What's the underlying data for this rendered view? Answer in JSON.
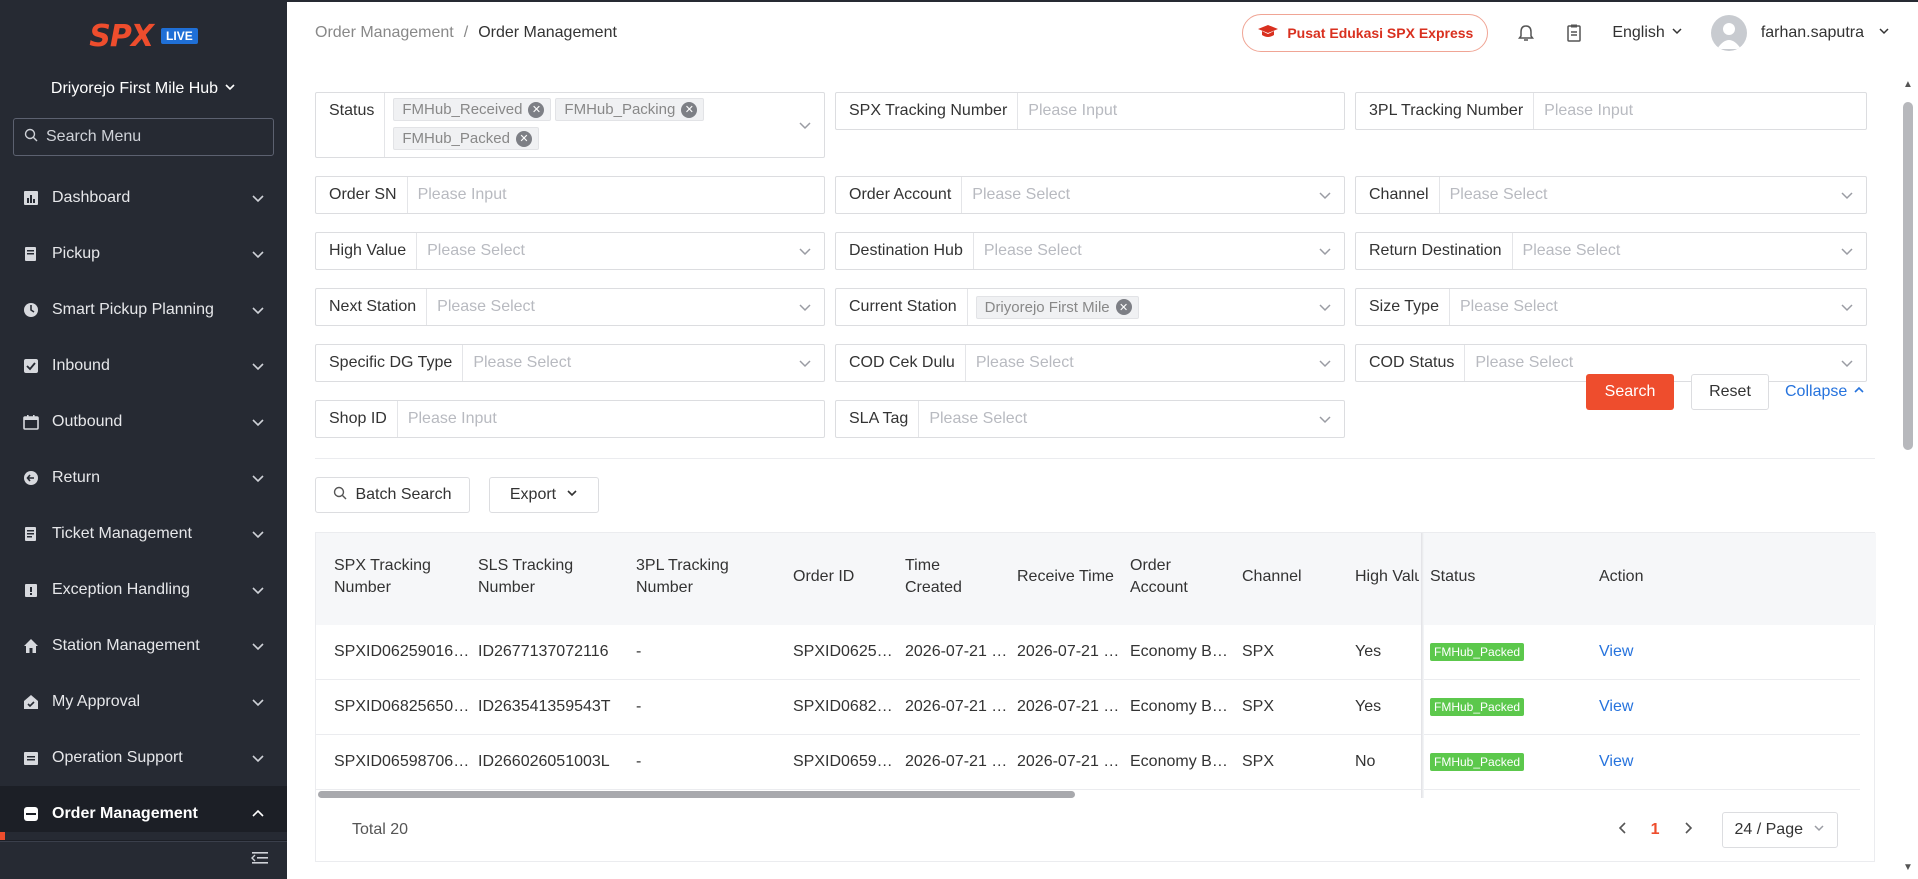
{
  "brand": {
    "logo": "SPX",
    "live_badge": "LIVE",
    "hub": "Driyorejo First Mile Hub"
  },
  "sidebar": {
    "search_placeholder": "Search Menu",
    "items": [
      {
        "label": "Dashboard",
        "icon": "dashboard-icon"
      },
      {
        "label": "Pickup",
        "icon": "pickup-icon"
      },
      {
        "label": "Smart Pickup Planning",
        "icon": "planning-icon"
      },
      {
        "label": "Inbound",
        "icon": "inbound-icon"
      },
      {
        "label": "Outbound",
        "icon": "outbound-icon"
      },
      {
        "label": "Return",
        "icon": "return-icon"
      },
      {
        "label": "Ticket Management",
        "icon": "ticket-icon"
      },
      {
        "label": "Exception Handling",
        "icon": "exception-icon"
      },
      {
        "label": "Station Management",
        "icon": "station-icon"
      },
      {
        "label": "My Approval",
        "icon": "approval-icon"
      },
      {
        "label": "Operation Support",
        "icon": "operation-support-icon"
      },
      {
        "label": "Order Management",
        "icon": "order-management-icon",
        "active": true
      }
    ]
  },
  "header": {
    "breadcrumb_parent": "Order Management",
    "breadcrumb_sep": "/",
    "breadcrumb_current": "Order Management",
    "edu_button": "Pusat Edukasi SPX Express",
    "language": "English",
    "username": "farhan.saputra"
  },
  "filters": {
    "status_label": "Status",
    "status_tags": [
      "FMHub_Received",
      "FMHub_Packing",
      "FMHub_Packed"
    ],
    "spx_tracking_label": "SPX Tracking Number",
    "spx_tracking_placeholder": "Please Input",
    "tpl_tracking_label": "3PL Tracking Number",
    "tpl_tracking_placeholder": "Please Input",
    "order_sn_label": "Order SN",
    "order_sn_placeholder": "Please Input",
    "order_account_label": "Order Account",
    "order_account_placeholder": "Please Select",
    "channel_label": "Channel",
    "channel_placeholder": "Please Select",
    "high_value_label": "High Value",
    "high_value_placeholder": "Please Select",
    "destination_hub_label": "Destination Hub",
    "destination_hub_placeholder": "Please Select",
    "return_destination_label": "Return Destination",
    "return_destination_placeholder": "Please Select",
    "next_station_label": "Next Station",
    "next_station_placeholder": "Please Select",
    "current_station_label": "Current Station",
    "current_station_tag": "Driyorejo First Mile",
    "size_type_label": "Size Type",
    "size_type_placeholder": "Please Select",
    "specific_dg_label": "Specific DG Type",
    "specific_dg_placeholder": "Please Select",
    "cod_cek_label": "COD Cek Dulu",
    "cod_cek_placeholder": "Please Select",
    "cod_status_label": "COD Status",
    "cod_status_placeholder": "Please Select",
    "shop_id_label": "Shop ID",
    "shop_id_placeholder": "Please Input",
    "sla_tag_label": "SLA Tag",
    "sla_tag_placeholder": "Please Select",
    "search_button": "Search",
    "reset_button": "Reset",
    "collapse_button": "Collapse"
  },
  "toolbar": {
    "batch_search": "Batch Search",
    "export": "Export"
  },
  "table": {
    "columns": [
      "SPX Tracking Number",
      "SLS Tracking Number",
      "3PL Tracking Number",
      "Order ID",
      "Time Created",
      "Receive Time",
      "Order Account",
      "Channel",
      "High Valu",
      "Status",
      "Action"
    ],
    "rows": [
      {
        "spx": "SPXID06259016…",
        "sls": "ID2677137072116",
        "tpl": "-",
        "order_id": "SPXID0625…",
        "created": "2026-07-21 …",
        "received": "2026-07-21 …",
        "account": "Economy B…",
        "channel": "SPX",
        "high_value": "Yes",
        "status": "FMHub_Packed",
        "action": "View"
      },
      {
        "spx": "SPXID06825650…",
        "sls": "ID263541359543T",
        "tpl": "-",
        "order_id": "SPXID0682…",
        "created": "2026-07-21 …",
        "received": "2026-07-21 …",
        "account": "Economy B…",
        "channel": "SPX",
        "high_value": "Yes",
        "status": "FMHub_Packed",
        "action": "View"
      },
      {
        "spx": "SPXID06598706…",
        "sls": "ID266026051003L",
        "tpl": "-",
        "order_id": "SPXID0659…",
        "created": "2026-07-21 …",
        "received": "2026-07-21 …",
        "account": "Economy B…",
        "channel": "SPX",
        "high_value": "No",
        "status": "FMHub_Packed",
        "action": "View"
      }
    ],
    "total": "Total 20",
    "current_page": "1",
    "page_size": "24 / Page"
  },
  "colors": {
    "accent": "#ee4d2d",
    "link": "#2673dd",
    "sidebar_bg": "#262a33",
    "status_green": "#5cc84c"
  }
}
